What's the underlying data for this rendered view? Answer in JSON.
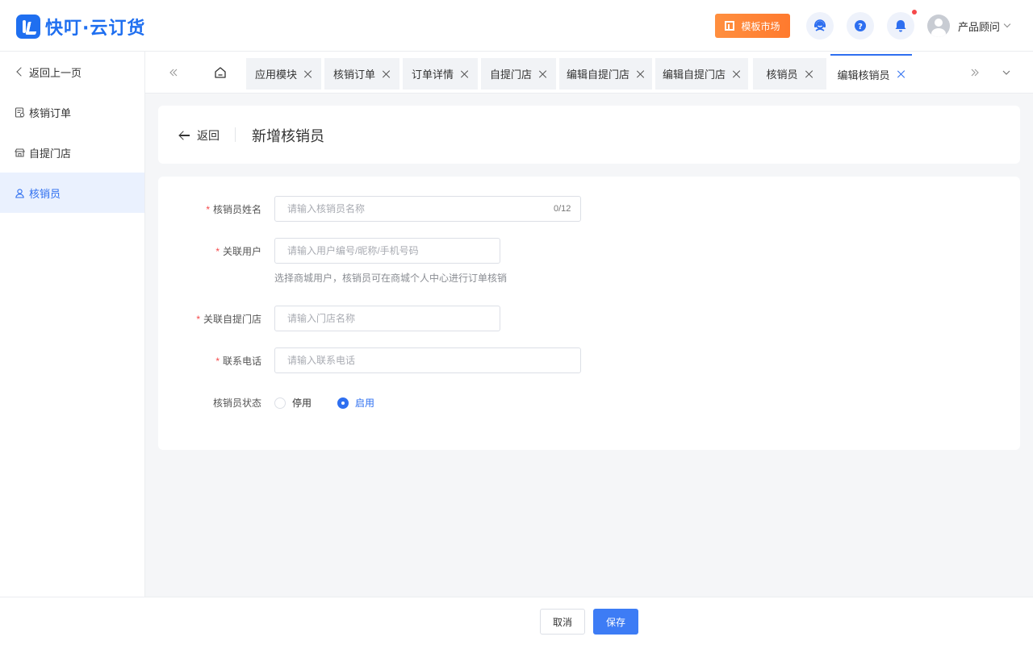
{
  "header": {
    "logo_text": "快叮·云订货",
    "market_label": "模板市场",
    "user_name": "产品顾问",
    "colors": {
      "brand": "#1f6ff0",
      "market": "#ff7a2e",
      "notification_dot": "#f5484a"
    },
    "icons": [
      "customer-service-icon",
      "help-icon",
      "bell-icon",
      "avatar",
      "chevron-down-icon"
    ]
  },
  "sidebar": {
    "back_label": "返回上一页",
    "items": [
      {
        "label": "核销订单",
        "icon": "order-icon"
      },
      {
        "label": "自提门店",
        "icon": "store-icon"
      },
      {
        "label": "核销员",
        "icon": "user-icon",
        "active": true
      }
    ]
  },
  "tabs": {
    "items": [
      {
        "label": "应用模块"
      },
      {
        "label": "核销订单"
      },
      {
        "label": "订单详情"
      },
      {
        "label": "自提门店"
      },
      {
        "label": "编辑自提门店"
      },
      {
        "label": "编辑自提门店"
      },
      {
        "label": "核销员"
      },
      {
        "label": "编辑核销员",
        "active": true
      }
    ]
  },
  "page": {
    "back_label": "返回",
    "title": "新增核销员"
  },
  "form": {
    "name": {
      "label": "核销员姓名",
      "placeholder": "请输入核销员名称",
      "counter": "0/12"
    },
    "user": {
      "label": "关联用户",
      "placeholder": "请输入用户编号/昵称/手机号码",
      "hint": "选择商城用户，核销员可在商城个人中心进行订单核销"
    },
    "store": {
      "label": "关联自提门店",
      "placeholder": "请输入门店名称"
    },
    "phone": {
      "label": "联系电话",
      "placeholder": "请输入联系电话"
    },
    "status": {
      "label": "核销员状态",
      "options": [
        "停用",
        "启用"
      ],
      "selected": "启用"
    }
  },
  "footer": {
    "cancel_label": "取消",
    "save_label": "保存",
    "primary_color": "#3d7cf5"
  }
}
